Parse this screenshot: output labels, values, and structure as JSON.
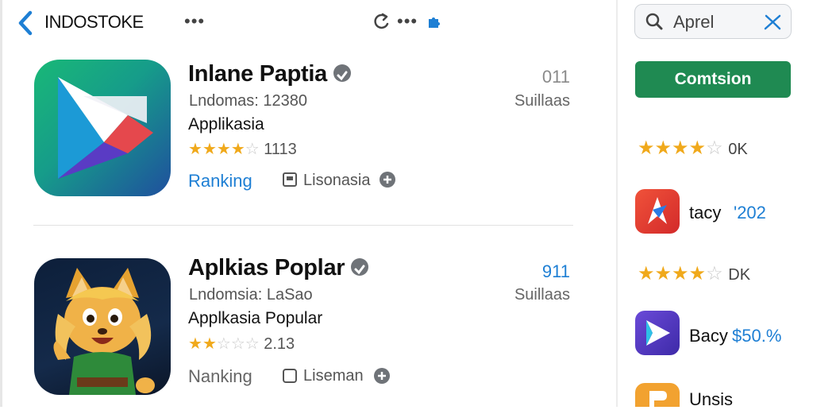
{
  "header": {
    "brand": "INDOSTOKE",
    "menu_dots": "•••",
    "share_dots": "•••"
  },
  "search": {
    "value": "Aprel"
  },
  "cta": {
    "label": "Comtsion"
  },
  "apps": [
    {
      "title": "Inlane Paptia",
      "subtitle": "Lndomas: 12380",
      "category": "Applikasia",
      "stars_filled": 4,
      "rating_text": "1113",
      "ranking_label": "Ranking",
      "license_label": "Lisonasia",
      "count": "011",
      "count_label": "Suillaas",
      "colors": {
        "ranking": "#1e7fd4",
        "count": "#8a8a8a"
      }
    },
    {
      "title": "Aplkias Poplar",
      "subtitle": "Lndomsia: LaSao",
      "category": "Applkasia Popular",
      "stars_filled": 2,
      "rating_text": "2.13",
      "ranking_label": "Nanking",
      "license_label": "Liseman",
      "count": "911",
      "count_label": "Suillaas",
      "colors": {
        "ranking": "#666666",
        "count": "#1e7fd4"
      }
    }
  ],
  "sidebar": {
    "rating1": {
      "stars_filled": 4,
      "value": "0K"
    },
    "app1": {
      "name": "tacy",
      "value": "'202"
    },
    "rating2": {
      "stars_filled": 4,
      "value": "DK"
    },
    "app2": {
      "name": "Bacy",
      "value": "$50.%"
    },
    "app3": {
      "name": "Unsis"
    }
  },
  "colors": {
    "accent_blue": "#1e7fd4",
    "cta_green": "#1f8a52",
    "star": "#f0a91b"
  }
}
